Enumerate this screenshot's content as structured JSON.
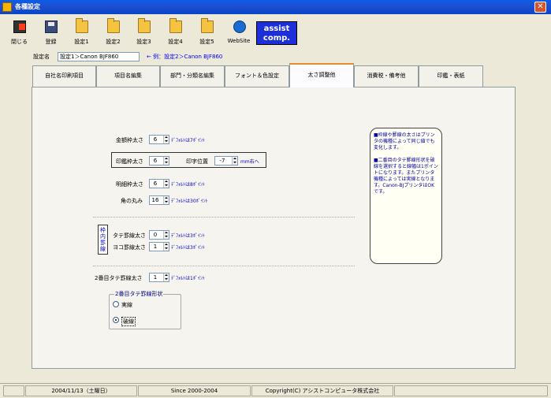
{
  "window": {
    "title": "各種設定"
  },
  "toolbar": {
    "close_label": "閉じる",
    "register_label": "登録",
    "settings": [
      "設定1",
      "設定2",
      "設定3",
      "設定4",
      "設定5"
    ],
    "website_label": "WebSite",
    "assist_line1": "assist",
    "assist_line2": "comp."
  },
  "setname": {
    "label": "設定名",
    "value": "設定1＞Canon BJF860",
    "example": "← 例：設定2＞Canon BJF860"
  },
  "tabs": [
    {
      "label": "自社名印刷項目"
    },
    {
      "label": "項目名編集"
    },
    {
      "label": "部門・分類名編集"
    },
    {
      "label": "フォント＆色設定"
    },
    {
      "label": "太さ調整他",
      "active": true
    },
    {
      "label": "消費税・備考他"
    },
    {
      "label": "印鑑・表紙"
    }
  ],
  "form": {
    "kingaku_label": "金額枠太さ",
    "kingaku_value": "6",
    "kingaku_hint": "ﾃﾞﾌｫﾙﾄは7ﾎﾟｲﾝﾄ",
    "inkan_label": "印鑑枠太さ",
    "inkan_value": "6",
    "insatsu_label": "印字位置",
    "insatsu_value": "-7",
    "insatsu_unit": "mm右へ",
    "meisai_label": "明細枠太さ",
    "meisai_value": "6",
    "meisai_hint": "ﾃﾞﾌｫﾙﾄは8ﾎﾟｲﾝﾄ",
    "kado_label": "角の丸み",
    "kado_value": "16",
    "kado_hint": "ﾃﾞﾌｫﾙﾄは30ﾎﾟｲﾝﾄ",
    "frame_label": "枠内罫線",
    "tate_label": "タテ罫線太さ",
    "tate_value": "0",
    "tate_hint": "ﾃﾞﾌｫﾙﾄは3ﾎﾟｲﾝﾄ",
    "yoko_label": "ヨコ罫線太さ",
    "yoko_value": "1",
    "yoko_hint": "ﾃﾞﾌｫﾙﾄは3ﾎﾟｲﾝﾄ",
    "second_label": "2番目タテ罫線太さ",
    "second_value": "1",
    "second_hint": "ﾃﾞﾌｫﾙﾄは1ﾎﾟｲﾝﾄ",
    "shape_legend": "2番目タテ罫線形状",
    "shape_solid": "実線",
    "shape_dashed": "破線",
    "shape_selected": "dashed"
  },
  "note": {
    "p1": "■枠線や罫線の太さはプリンタの機種によって同じ値でも変化します。",
    "p2": "■二番目のタテ罫線形状を破線を選択すると線幅は1ポイントになります。またプリンタ機種によっては実線となります。Canon-BJプリンタはOKです。"
  },
  "status": {
    "date": "2004/11/13（土曜日）",
    "since": "Since 2000-2004",
    "copyright": "Copyright(C) アシストコンピュータ株式会社"
  }
}
